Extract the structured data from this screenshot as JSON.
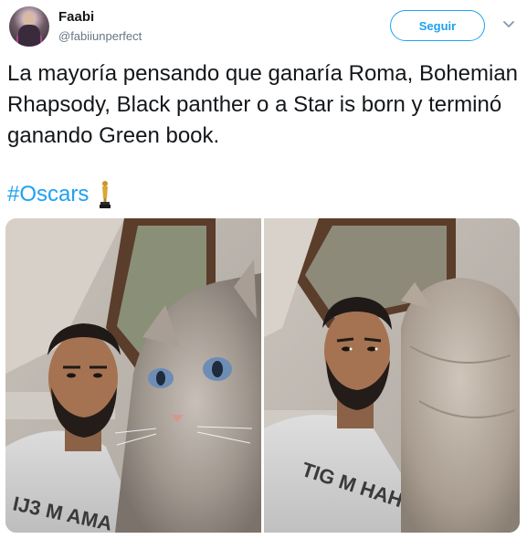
{
  "user": {
    "name": "Faabi",
    "handle": "@fabiiunperfect"
  },
  "follow_button": {
    "label": "Seguir"
  },
  "tweet": {
    "text": "La mayoría pensando que ganaría Roma, Bohemian Rhapsody, Black panther o a Star is born y terminó ganando Green book.",
    "hashtag": "#Oscars"
  },
  "photos": {
    "left_shirt_text": "IJ3 M AMA",
    "right_shirt_text": "TIG M HAHI"
  },
  "colors": {
    "accent": "#1da1f2",
    "text": "#14171a",
    "secondary": "#657786"
  },
  "icons": {
    "more": "chevron-down-icon",
    "hashtag_emoji": "oscar-trophy-icon"
  }
}
